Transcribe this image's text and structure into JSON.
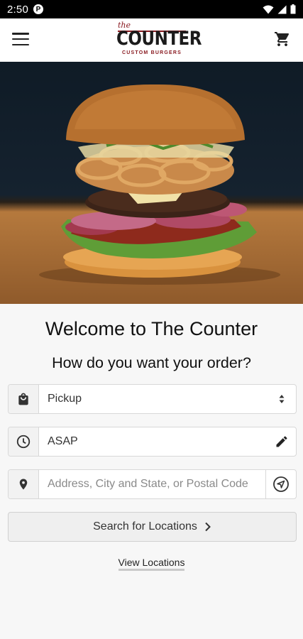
{
  "status_bar": {
    "time": "2:50",
    "app_icon_letter": "P"
  },
  "header": {
    "logo": {
      "the": "the",
      "name": "COUNTER",
      "tagline": "CUSTOM BURGERS"
    },
    "menu_icon": "hamburger-menu-icon",
    "cart_icon": "shopping-cart-icon"
  },
  "hero": {
    "description_icon": "burger-photo"
  },
  "main": {
    "welcome": "Welcome to The Counter",
    "question": "How do you want your order?",
    "order_type": {
      "icon": "shopping-bag-icon",
      "value": "Pickup"
    },
    "time": {
      "icon": "clock-icon",
      "value": "ASAP"
    },
    "address": {
      "icon": "location-pin-icon",
      "placeholder": "Address, City and State, or Postal Code"
    },
    "search_button": "Search for Locations",
    "view_locations": "View Locations"
  },
  "colors": {
    "brand_red": "#8a1c22",
    "background": "#f7f7f7"
  }
}
